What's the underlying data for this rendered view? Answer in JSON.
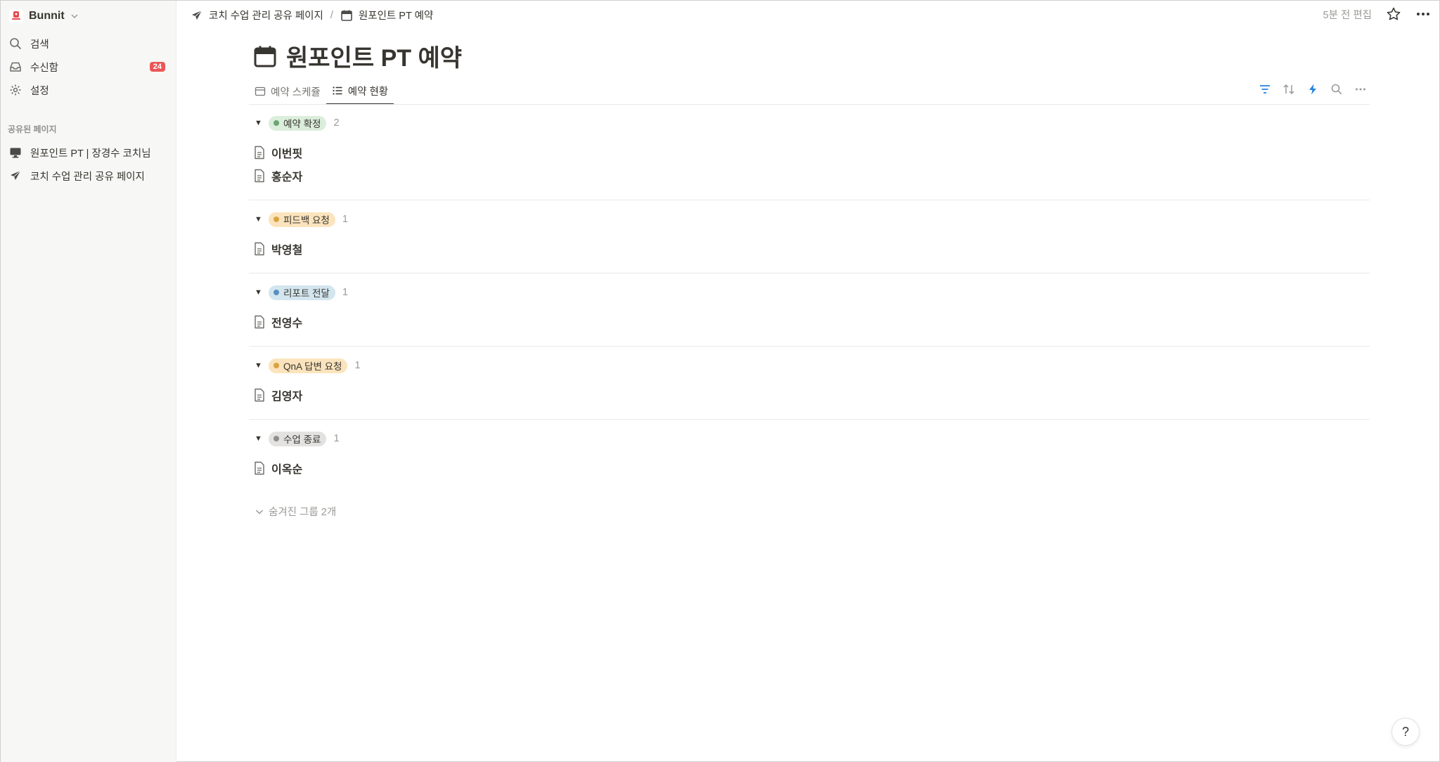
{
  "workspace": {
    "name": "Bunnit",
    "logo_icon": "bunnit-logo-icon"
  },
  "sidebar": {
    "items": [
      {
        "label": "검색",
        "icon": "search-icon"
      },
      {
        "label": "수신함",
        "icon": "inbox-icon",
        "badge": "24"
      },
      {
        "label": "설정",
        "icon": "gear-icon"
      }
    ],
    "section_title": "공유된 페이지",
    "shared_pages": [
      {
        "label": "원포인트 PT | 장경수 코치님",
        "icon": "monitor-icon"
      },
      {
        "label": "코치 수업 관리 공유 페이지",
        "icon": "paper-plane-icon"
      }
    ]
  },
  "breadcrumb": [
    {
      "label": "코치 수업 관리 공유 페이지",
      "icon": "paper-plane-icon"
    },
    {
      "label": "원포인트 PT 예약",
      "icon": "calendar-icon"
    }
  ],
  "breadcrumb_sep": "/",
  "topbar": {
    "edited": "5분 전 편집"
  },
  "page": {
    "title": "원포인트 PT 예약",
    "icon": "calendar-icon"
  },
  "tabs": [
    {
      "label": "예약 스케쥴",
      "icon": "calendar-view-icon",
      "active": false
    },
    {
      "label": "예약 현황",
      "icon": "list-view-icon",
      "active": true
    }
  ],
  "groups": [
    {
      "label": "예약 확정",
      "count": "2",
      "color": "#6aa574",
      "bg": "#dbeddb",
      "rows": [
        "이번핏",
        "홍순자"
      ]
    },
    {
      "label": "피드백 요청",
      "count": "1",
      "color": "#d9a441",
      "bg": "#fbe4bd",
      "rows": [
        "박영철"
      ]
    },
    {
      "label": "리포트 전달",
      "count": "1",
      "color": "#5a8fbf",
      "bg": "#d3e5ef",
      "rows": [
        "전영수"
      ]
    },
    {
      "label": "QnA 답변 요청",
      "count": "1",
      "color": "#d9a441",
      "bg": "#fbe4bd",
      "rows": [
        "김영자"
      ]
    },
    {
      "label": "수업 종료",
      "count": "1",
      "color": "#8f8e8a",
      "bg": "#e3e2e0",
      "rows": [
        "이옥순"
      ]
    }
  ],
  "hidden_groups": "숨겨진 그룹 2개",
  "help": "?"
}
